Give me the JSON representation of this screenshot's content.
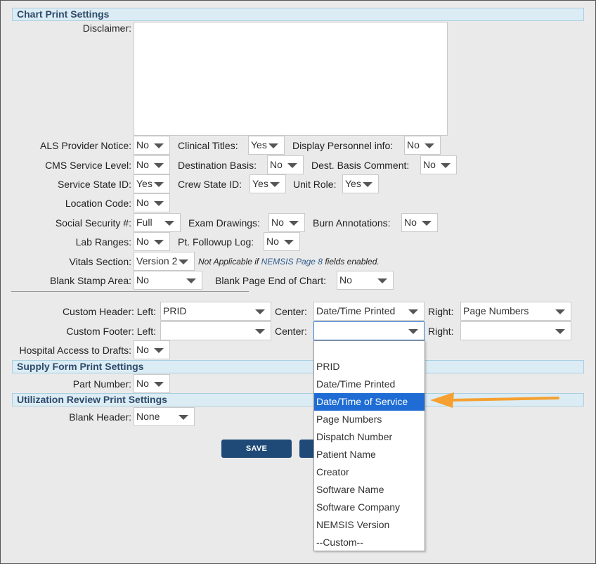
{
  "chart_print": {
    "section_title": "Chart Print Settings",
    "disclaimer_label": "Disclaimer:",
    "disclaimer_value": "",
    "als_label": "ALS Provider Notice:",
    "als_value": "No",
    "clinical_titles_label": "Clinical Titles:",
    "clinical_titles_value": "Yes",
    "display_personnel_label": "Display Personnel info:",
    "display_personnel_value": "No",
    "cms_label": "CMS Service Level:",
    "cms_value": "No",
    "destination_basis_label": "Destination Basis:",
    "destination_basis_value": "No",
    "dest_comment_label": "Dest. Basis Comment:",
    "dest_comment_value": "No",
    "service_state_label": "Service State ID:",
    "service_state_value": "Yes",
    "crew_state_label": "Crew State ID:",
    "crew_state_value": "Yes",
    "unit_role_label": "Unit Role:",
    "unit_role_value": "Yes",
    "location_code_label": "Location Code:",
    "location_code_value": "No",
    "ssn_label": "Social Security #:",
    "ssn_value": "Full",
    "exam_drawings_label": "Exam Drawings:",
    "exam_drawings_value": "No",
    "burn_label": "Burn Annotations:",
    "burn_value": "No",
    "lab_ranges_label": "Lab Ranges:",
    "lab_ranges_value": "No",
    "followup_label": "Pt. Followup Log:",
    "followup_value": "No",
    "vitals_label": "Vitals Section:",
    "vitals_value": "Version 2",
    "vitals_note_pre": "Not Applicable if ",
    "vitals_note_link": "NEMSIS Page 8",
    "vitals_note_post": " fields enabled.",
    "stamp_label": "Blank Stamp Area:",
    "stamp_value": "No",
    "blank_page_label": "Blank Page End of Chart:",
    "blank_page_value": "No",
    "header_label": "Custom Header: Left:",
    "header_left": "PRID",
    "center_label": "Center:",
    "header_center": "Date/Time Printed",
    "right_label": "Right:",
    "header_right": "Page Numbers",
    "footer_label": "Custom Footer: Left:",
    "footer_left": "",
    "footer_center": "",
    "footer_right": "",
    "drafts_label": "Hospital Access to Drafts:",
    "drafts_value": "No"
  },
  "supply_form": {
    "section_title": "Supply Form Print Settings",
    "part_number_label": "Part Number:",
    "part_number_value": "No"
  },
  "utilization": {
    "section_title": "Utilization Review Print Settings",
    "blank_header_label": "Blank Header:",
    "blank_header_value": "None"
  },
  "buttons": {
    "save": "SAVE",
    "second": ""
  },
  "dropdown": {
    "options": [
      "",
      "PRID",
      "Date/Time Printed",
      "Date/Time of Service",
      "Page Numbers",
      "Dispatch Number",
      "Patient Name",
      "Creator",
      "Software Name",
      "Software Company",
      "NEMSIS Version",
      "--Custom--"
    ],
    "highlighted": "Date/Time of Service"
  },
  "colors": {
    "section_bg": "#dcecf4",
    "button": "#1f4a78",
    "highlight": "#1f6dd4",
    "arrow": "#f5a030"
  }
}
